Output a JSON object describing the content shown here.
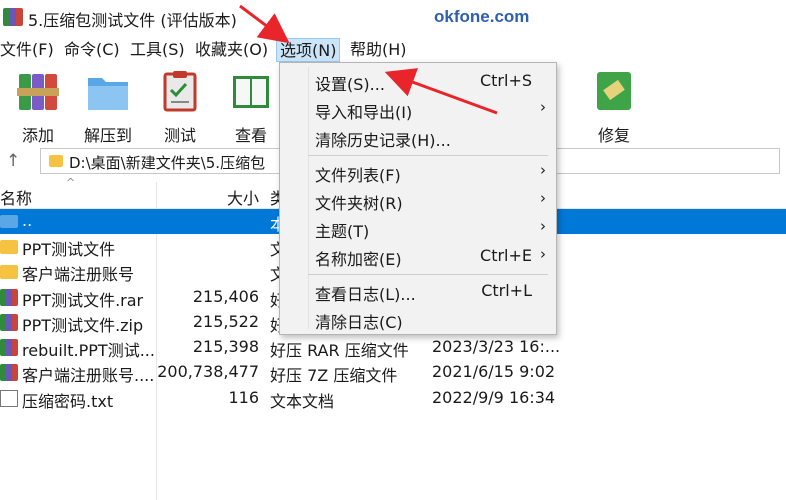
{
  "window": {
    "title": "5.压缩包测试文件 (评估版本)",
    "watermark": "okfone.com"
  },
  "menubar": {
    "items": [
      "文件(F)",
      "命令(C)",
      "工具(S)",
      "收藏夹(O)",
      "选项(N)",
      "帮助(H)"
    ],
    "active": "选项(N)"
  },
  "toolbar": {
    "items": [
      {
        "label": "添加",
        "icon": "add-archive-icon"
      },
      {
        "label": "解压到",
        "icon": "extract-folder-icon"
      },
      {
        "label": "测试",
        "icon": "test-clipboard-icon"
      },
      {
        "label": "查看",
        "icon": "view-book-icon"
      },
      {
        "label": "修复",
        "icon": "repair-kit-icon"
      }
    ]
  },
  "address": {
    "path": "D:\\桌面\\新建文件夹\\5.压缩包"
  },
  "columns": {
    "name": "名称",
    "size": "大小",
    "type": "类"
  },
  "files": [
    {
      "name": "..",
      "size": "",
      "type": "本",
      "date": "",
      "icon": "parent-folder-icon",
      "selected": true
    },
    {
      "name": "PPT测试文件",
      "size": "",
      "type": "文",
      "date": "",
      "icon": "folder-icon"
    },
    {
      "name": "客户端注册账号",
      "size": "",
      "type": "文",
      "date": "",
      "icon": "folder-icon"
    },
    {
      "name": "PPT测试文件.rar",
      "size": "215,406",
      "type": "好",
      "date": "",
      "icon": "rar-archive-icon"
    },
    {
      "name": "PPT测试文件.zip",
      "size": "215,522",
      "type": "好",
      "date": "",
      "icon": "rar-archive-icon"
    },
    {
      "name": "rebuilt.PPT测试...",
      "size": "215,398",
      "type": "好压 RAR 压缩文件",
      "date": "2023/3/23 16:...",
      "icon": "rar-archive-icon"
    },
    {
      "name": "客户端注册账号....",
      "size": "200,738,477",
      "type": "好压 7Z 压缩文件",
      "date": "2021/6/15 9:02",
      "icon": "rar-archive-icon"
    },
    {
      "name": "压缩密码.txt",
      "size": "116",
      "type": "文本文档",
      "date": "2022/9/9 16:34",
      "icon": "text-file-icon"
    }
  ],
  "options_menu": {
    "items": [
      {
        "label": "设置(S)...",
        "shortcut": "Ctrl+S",
        "submenu": false
      },
      {
        "label": "导入和导出(I)",
        "shortcut": "",
        "submenu": true
      },
      {
        "label": "清除历史记录(H)...",
        "shortcut": "",
        "submenu": false
      },
      {
        "label": "文件列表(F)",
        "shortcut": "",
        "submenu": true
      },
      {
        "label": "文件夹树(R)",
        "shortcut": "",
        "submenu": true
      },
      {
        "label": "主题(T)",
        "shortcut": "",
        "submenu": true
      },
      {
        "label": "名称加密(E)",
        "shortcut": "Ctrl+E",
        "submenu": true
      },
      {
        "label": "查看日志(L)...",
        "shortcut": "Ctrl+L",
        "submenu": false
      },
      {
        "label": "清除日志(C)",
        "shortcut": "",
        "submenu": false
      }
    ]
  },
  "glyphs": {
    "submenu_arrow": "›",
    "up_arrow": "↑",
    "sort_caret": "^"
  },
  "colors": {
    "selection": "#0078d7",
    "menu_highlight": "#cce4f7",
    "annotation_arrow": "#e8252a",
    "watermark": "#2f5fb3"
  }
}
